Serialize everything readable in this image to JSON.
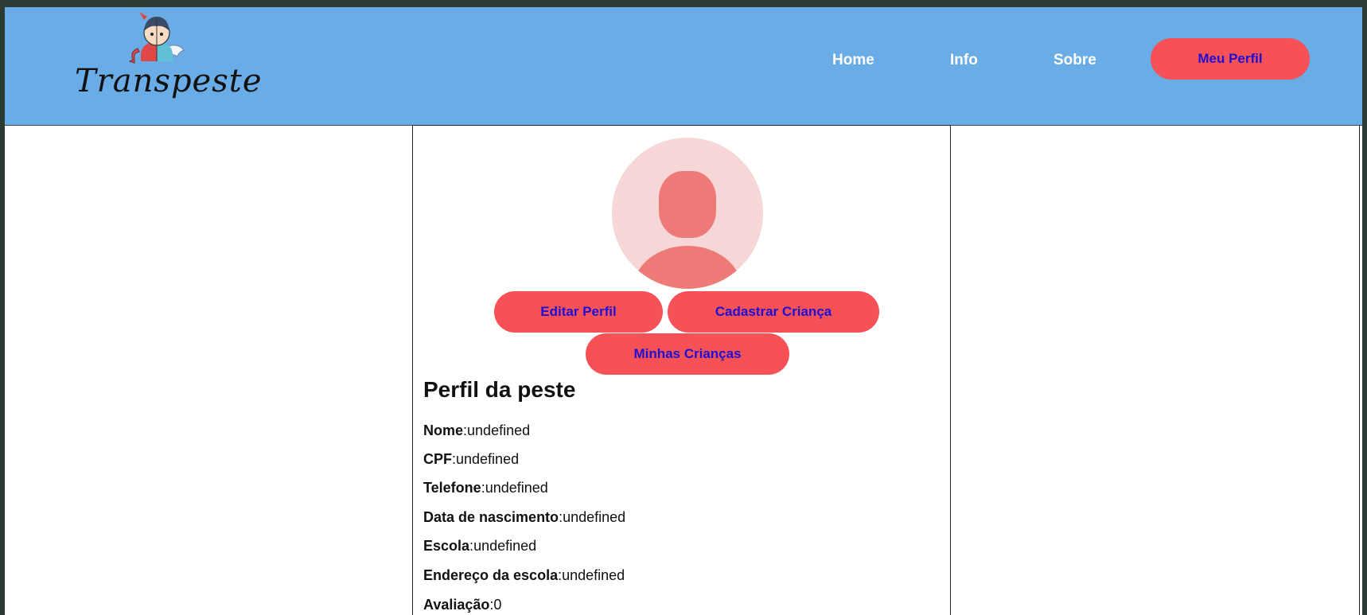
{
  "brand": {
    "name": "Transpeste"
  },
  "nav": {
    "home": "Home",
    "info": "Info",
    "about": "Sobre",
    "profile": "Meu Perfil"
  },
  "actions": {
    "edit_profile": "Editar Perfil",
    "register_child": "Cadastrar Criança",
    "my_children": "Minhas Crianças"
  },
  "profile": {
    "title": "Perfil da peste",
    "fields": [
      {
        "label": "Nome",
        "value": "undefined"
      },
      {
        "label": "CPF",
        "value": "undefined"
      },
      {
        "label": "Telefone",
        "value": "undefined"
      },
      {
        "label": "Data de nascimento",
        "value": "undefined"
      },
      {
        "label": "Escola",
        "value": "undefined"
      },
      {
        "label": "Endereço da escola",
        "value": "undefined"
      },
      {
        "label": "Avaliação",
        "value": "0"
      }
    ]
  },
  "colors": {
    "navbar": "#69ace6",
    "accent": "#f55157",
    "button_text": "#1e0fd6",
    "avatar_bg": "#f7d6d8",
    "avatar_fg": "#ee7a78"
  },
  "icons": {
    "mascot": "devil-angel-mascot-icon",
    "avatar": "user-silhouette-icon"
  }
}
